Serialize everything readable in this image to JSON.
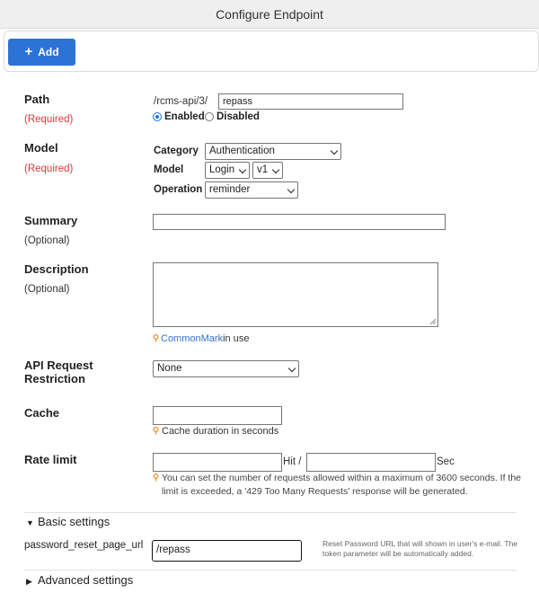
{
  "header": {
    "title": "Configure Endpoint"
  },
  "toolbar": {
    "add_label": "Add"
  },
  "path": {
    "label": "Path",
    "note": "(Required)",
    "prefix": "/rcms-api/3/",
    "value": "repass",
    "enabled_label": "Enabled",
    "disabled_label": "Disabled"
  },
  "model": {
    "label": "Model",
    "note": "(Required)",
    "category_label": "Category",
    "category_value": "Authentication",
    "model_label": "Model",
    "model_value": "Login",
    "version_value": "v1",
    "operation_label": "Operation",
    "operation_value": "reminder"
  },
  "summary": {
    "label": "Summary",
    "note": "(Optional)",
    "value": ""
  },
  "description": {
    "label": "Description",
    "note": "(Optional)",
    "value": "",
    "hint_link": "CommonMark",
    "hint_text": "in use"
  },
  "api_restriction": {
    "label_line1": "API Request",
    "label_line2": "Restriction",
    "value": "None"
  },
  "cache": {
    "label": "Cache",
    "value": "",
    "hint": "Cache duration in seconds"
  },
  "rate_limit": {
    "label": "Rate limit",
    "hit_label": "Hit /",
    "sec_label": "Sec",
    "hint_line1": "You can set the number of requests allowed within a maximum of 3600 seconds. If the",
    "hint_line2": "limit is exceeded, a '429 Too Many Requests' response will be generated."
  },
  "basic_settings": {
    "title": "Basic settings",
    "field_label": "password_reset_page_url",
    "field_value": "/repass",
    "help_line1": "Reset Password URL that will shown in user's e-mail. The",
    "help_line2": "token parameter will be automatically added."
  },
  "advanced_settings": {
    "title": "Advanced settings"
  },
  "colors": {
    "primary": "#2d73d6",
    "required": "#e0373a",
    "hint_icon": "#f08a24"
  }
}
